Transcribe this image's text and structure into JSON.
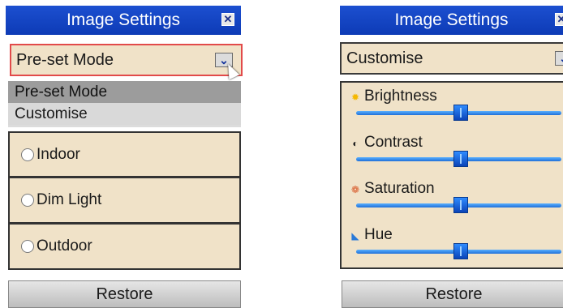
{
  "left_panel": {
    "title": "Image Settings",
    "close_glyph": "✕",
    "select_value": "Pre-set Mode",
    "arrow_glyph": "⌄",
    "dropdown_options": [
      "Pre-set Mode",
      "Customise"
    ],
    "radio_options": [
      "Indoor",
      "Dim Light",
      "Outdoor"
    ],
    "restore_label": "Restore"
  },
  "right_panel": {
    "title": "Image Settings",
    "close_glyph": "✕",
    "select_value": "Customise",
    "arrow_glyph": "⌄",
    "sliders": [
      {
        "label": "Brightness",
        "icon": "brightness-icon",
        "value_percent": 51
      },
      {
        "label": "Contrast",
        "icon": "contrast-icon",
        "value_percent": 51
      },
      {
        "label": "Saturation",
        "icon": "saturation-icon",
        "value_percent": 51
      },
      {
        "label": "Hue",
        "icon": "hue-icon",
        "value_percent": 51
      }
    ],
    "restore_label": "Restore"
  },
  "colors": {
    "title_bar": "#1244c4",
    "panel_bg": "#f0e2c8",
    "slider_blue": "#1f70d8",
    "select_highlight_border": "#e24a4a"
  }
}
